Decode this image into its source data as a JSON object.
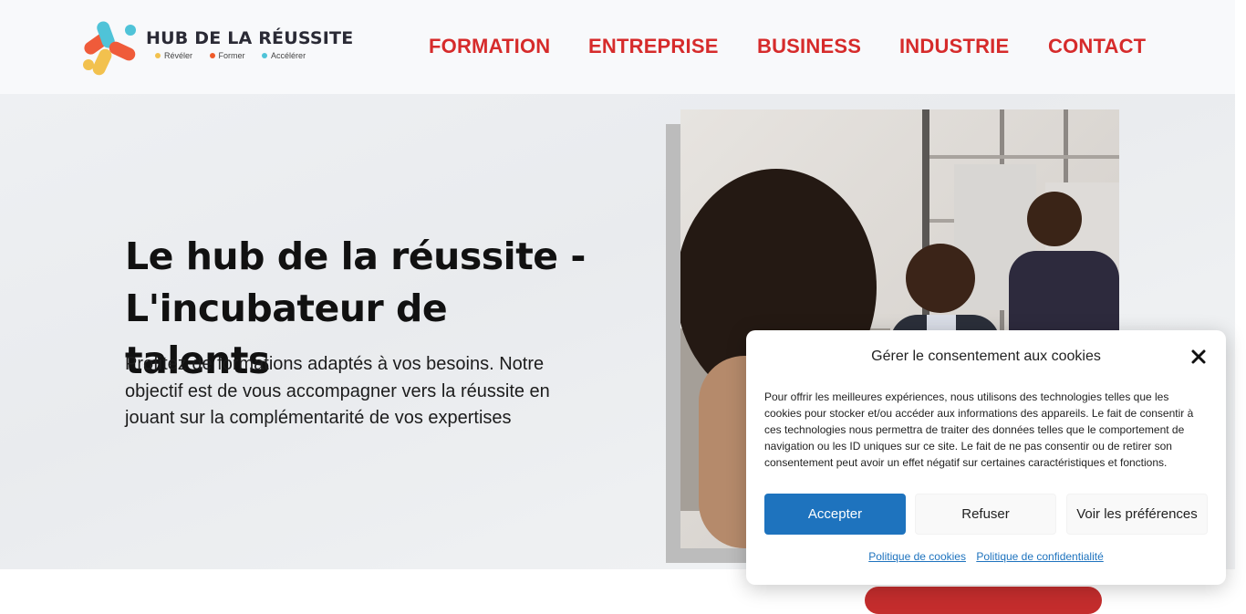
{
  "brand": {
    "name": "HUB DE LA RÉUSSITE",
    "tags": [
      "Révéler",
      "Former",
      "Accélérer"
    ],
    "tag_colors": [
      "#f2c14e",
      "#ef5b2a",
      "#4fc3d8"
    ]
  },
  "nav": {
    "items": [
      "FORMATION",
      "ENTREPRISE",
      "BUSINESS",
      "INDUSTRIE",
      "CONTACT"
    ],
    "color": "#d62b2b"
  },
  "hero": {
    "title": "Le hub de la réussite - L'incubateur de talents",
    "text": "Profitez de formations adaptés à vos besoins. Notre objectif est de vous accompagner vers la réussite en jouant sur la complémentarité de vos expertises",
    "image": "team-meeting-photo"
  },
  "cookie": {
    "title": "Gérer le consentement aux cookies",
    "body": "Pour offrir les meilleures expériences, nous utilisons des technologies telles que les cookies pour stocker et/ou accéder aux informations des appareils. Le fait de consentir à ces technologies nous permettra de traiter des données telles que le comportement de navigation ou les ID uniques sur ce site. Le fait de ne pas consentir ou de retirer son consentement peut avoir un effet négatif sur certaines caractéristiques et fonctions.",
    "accept_label": "Accepter",
    "refuse_label": "Refuser",
    "prefs_label": "Voir les préférences",
    "cookie_policy_label": "Politique de cookies",
    "privacy_policy_label": "Politique de confidentialité",
    "accent": "#1e73be"
  }
}
